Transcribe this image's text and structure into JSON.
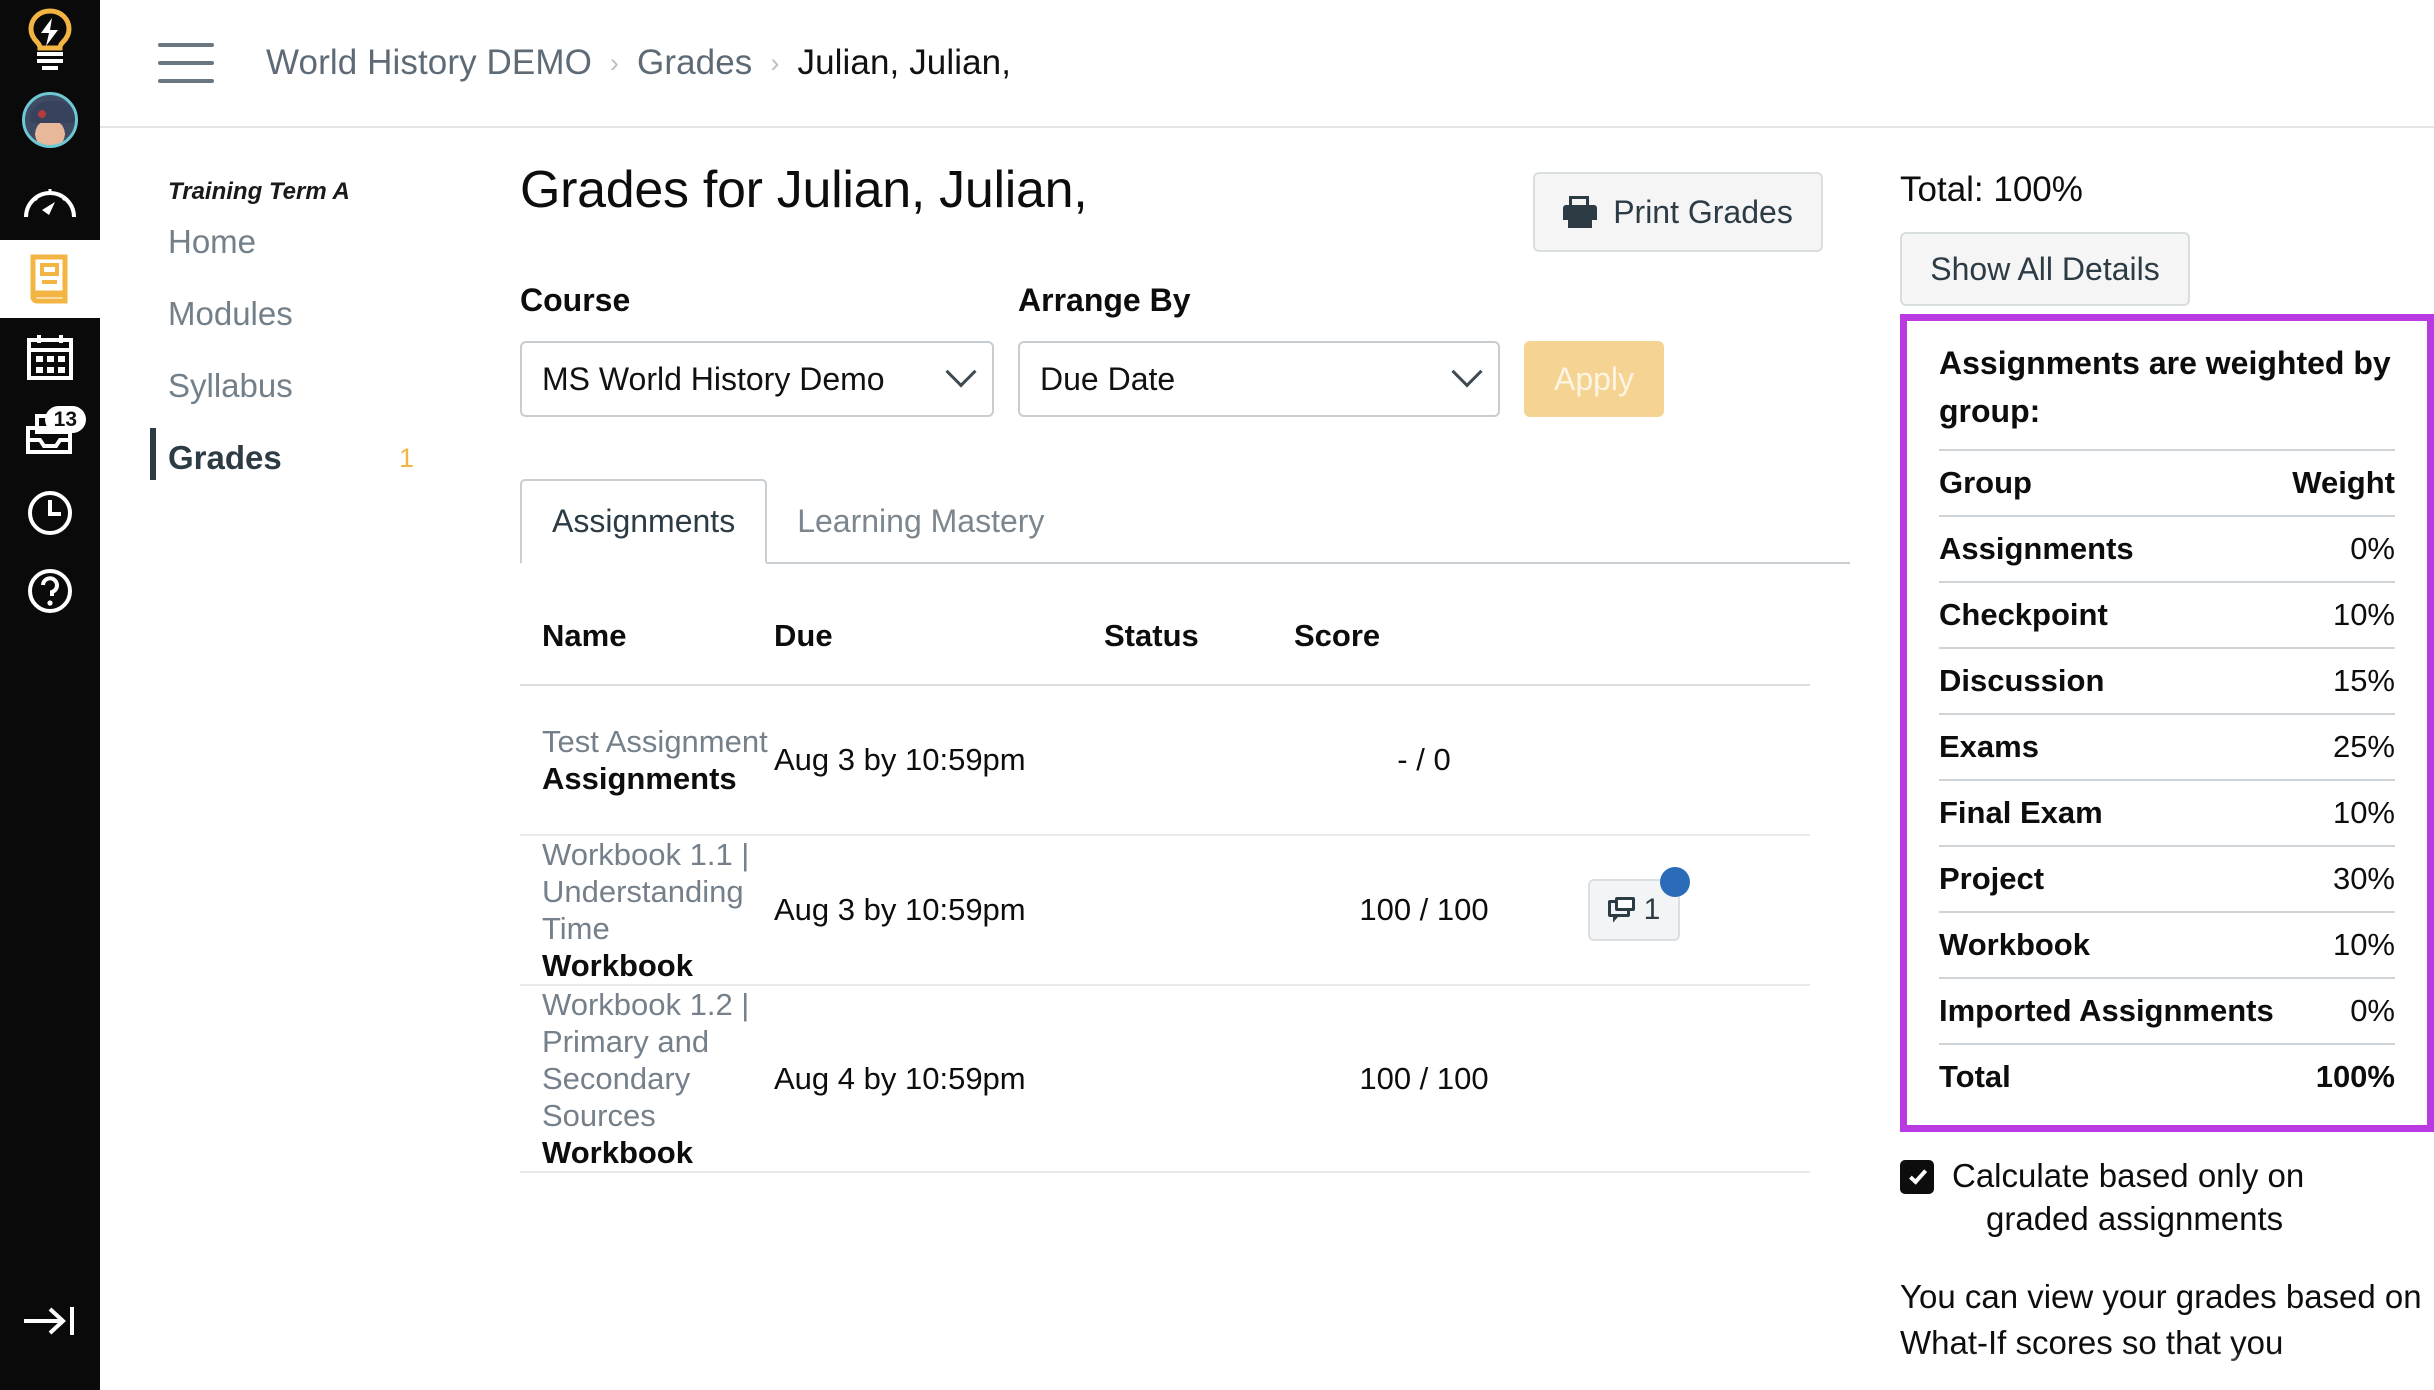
{
  "global_nav": {
    "items": [
      {
        "name": "lightbulb-logo",
        "icon": "lightbulb-icon",
        "label": ""
      },
      {
        "name": "account",
        "icon": "avatar-icon",
        "label": ""
      },
      {
        "name": "dashboard",
        "icon": "dashboard-gauge-icon",
        "label": ""
      },
      {
        "name": "courses",
        "icon": "book-icon",
        "label": "",
        "active": true
      },
      {
        "name": "calendar",
        "icon": "calendar-icon",
        "label": ""
      },
      {
        "name": "inbox",
        "icon": "inbox-icon",
        "label": "",
        "badge": "13"
      },
      {
        "name": "history",
        "icon": "clock-icon",
        "label": ""
      },
      {
        "name": "help",
        "icon": "question-circle-icon",
        "label": ""
      }
    ],
    "collapse_label": "",
    "badge_inbox": "13"
  },
  "topbar": {
    "menu_icon": "hamburger-icon",
    "breadcrumb": [
      {
        "label": "World History DEMO",
        "current": false
      },
      {
        "label": "Grades",
        "current": false
      },
      {
        "label": "Julian, Julian,",
        "current": true
      }
    ],
    "separator": "›"
  },
  "course_nav": {
    "term": "Training Term A",
    "items": [
      {
        "label": "Home",
        "active": false,
        "badge": ""
      },
      {
        "label": "Modules",
        "active": false,
        "badge": ""
      },
      {
        "label": "Syllabus",
        "active": false,
        "badge": ""
      },
      {
        "label": "Grades",
        "active": true,
        "badge": "1"
      }
    ]
  },
  "main": {
    "page_title": "Grades for Julian, Julian,",
    "print_button": "Print Grades",
    "filters": {
      "course_label": "Course",
      "course_value": "MS World History Demo",
      "arrange_label": "Arrange By",
      "arrange_value": "Due Date",
      "apply_label": "Apply"
    },
    "tabs": [
      {
        "label": "Assignments",
        "active": true
      },
      {
        "label": "Learning Mastery",
        "active": false
      }
    ],
    "table": {
      "columns": [
        "Name",
        "Due",
        "Status",
        "Score"
      ],
      "rows": [
        {
          "name": "Test Assignment",
          "group": "Assignments",
          "due": "Aug 3 by 10:59pm",
          "status": "",
          "score": "- / 0",
          "comments": ""
        },
        {
          "name": "Workbook 1.1 | Understanding Time",
          "group": "Workbook",
          "due": "Aug 3 by 10:59pm",
          "status": "",
          "score": "100 / 100",
          "comments": "1"
        },
        {
          "name": "Workbook 1.2 | Primary and Secondary Sources",
          "group": "Workbook",
          "due": "Aug 4 by 10:59pm",
          "status": "",
          "score": "100 / 100",
          "comments": ""
        }
      ]
    }
  },
  "right_panel": {
    "total_line": "Total: 100%",
    "show_details_button": "Show All Details",
    "weights_title": "Assignments are weighted by group:",
    "weights_header": {
      "group": "Group",
      "weight": "Weight"
    },
    "weights": [
      {
        "group": "Assignments",
        "weight": "0%"
      },
      {
        "group": "Checkpoint",
        "weight": "10%"
      },
      {
        "group": "Discussion",
        "weight": "15%"
      },
      {
        "group": "Exams",
        "weight": "25%"
      },
      {
        "group": "Final Exam",
        "weight": "10%"
      },
      {
        "group": "Project",
        "weight": "30%"
      },
      {
        "group": "Workbook",
        "weight": "10%"
      },
      {
        "group": "Imported Assignments",
        "weight": "0%"
      }
    ],
    "weights_total": {
      "group": "Total",
      "weight": "100%"
    },
    "calculate_checkbox_line1": "Calculate based only on",
    "calculate_checkbox_line2": "graded assignments",
    "whatif_text": "You can view your grades based on What-If scores so that you",
    "highlight_color": "#b83ae0"
  }
}
